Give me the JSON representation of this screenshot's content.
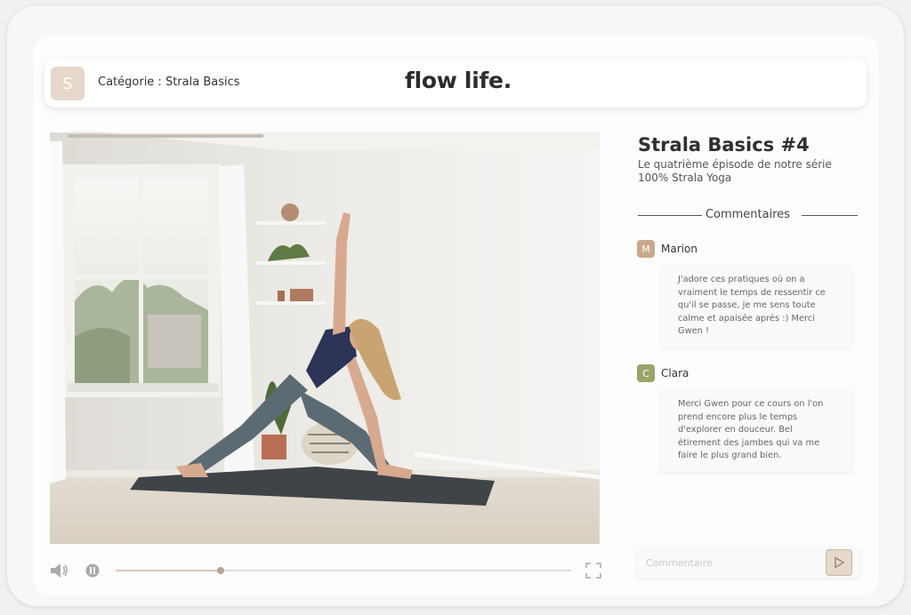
{
  "header": {
    "category_initial": "S",
    "category_label": "Catégorie : Strala Basics",
    "brand": "flow life."
  },
  "video": {
    "title": "Strala Basics #4",
    "description": "Le quatrième  épisode de notre série\n100% Strala Yoga",
    "progress": 0.23
  },
  "comments_section": {
    "heading": "Commentaires",
    "items": [
      {
        "initial": "M",
        "name": "Marion",
        "avatar_color": "#c9a98a",
        "text": "J'adore ces pratiques où on a vraiment le temps de ressentir ce qu'il se passe, je me sens toute calme et apaisée après :) Merci Gwen !"
      },
      {
        "initial": "C",
        "name": "Clara",
        "avatar_color": "#9aa468",
        "text": "Merci Gwen pour ce cours on l'on prend encore plus le temps d'explorer en douceur. Bel étirement des jambes qui va me faire le plus grand bien."
      }
    ],
    "input_placeholder": "Commentaire"
  },
  "colors": {
    "accent": "#e6d8ca",
    "accent_dark": "#b4a492"
  },
  "icons": {
    "volume": "speaker-icon",
    "pause": "pause-icon",
    "fullscreen": "fullscreen-icon",
    "send": "send-icon"
  }
}
